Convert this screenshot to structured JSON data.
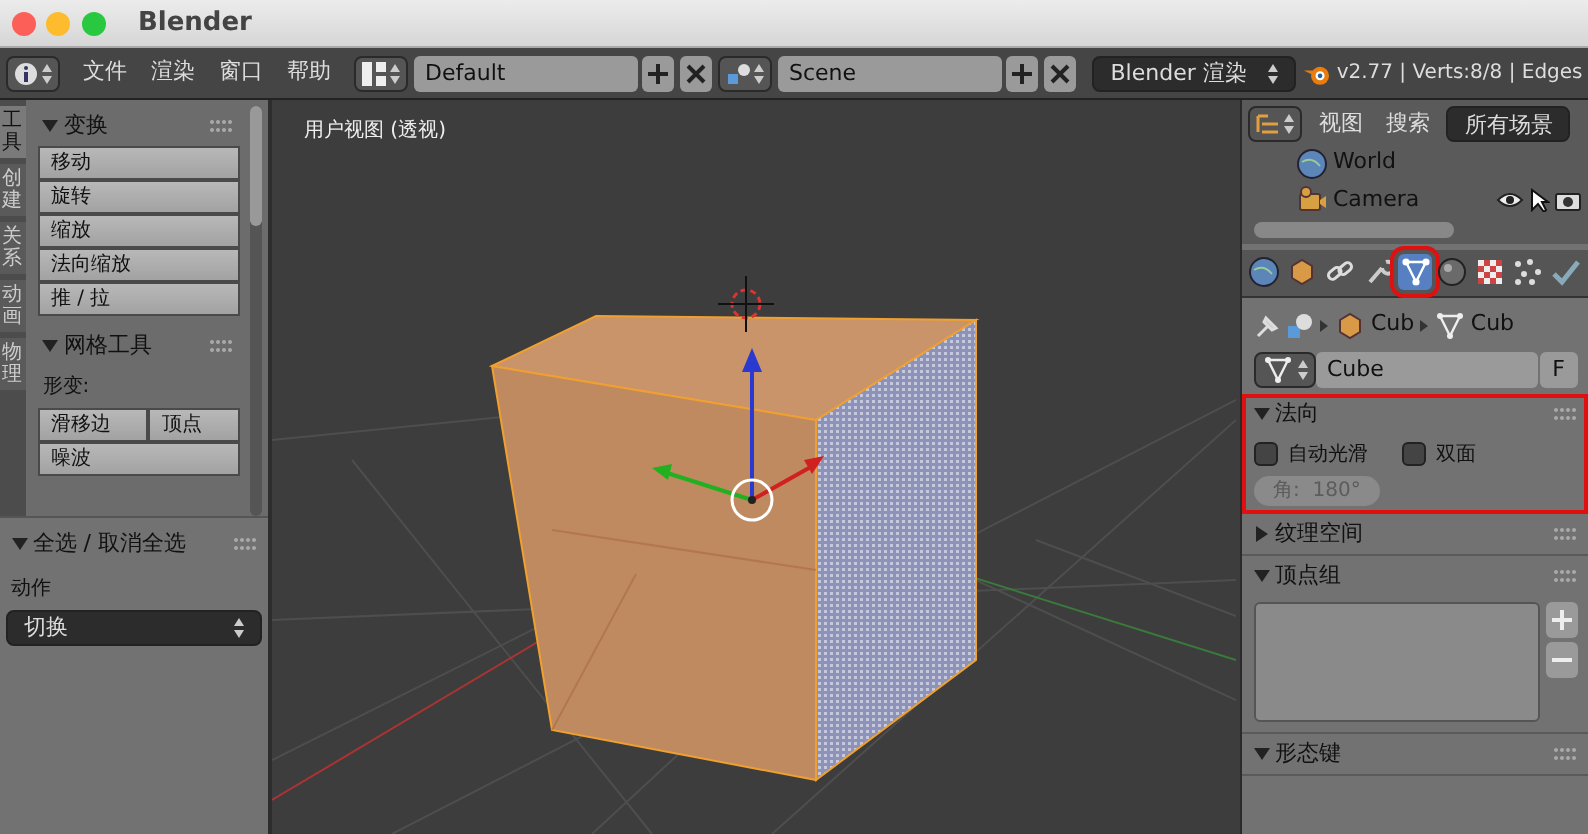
{
  "window": {
    "title": "Blender"
  },
  "header": {
    "menus": [
      "文件",
      "渲染",
      "窗口",
      "帮助"
    ],
    "screen_layout": "Default",
    "scene": "Scene",
    "render_engine": "Blender 渲染",
    "stats": "v2.77 | Verts:8/8 | Edges"
  },
  "tool_shelf": {
    "tabs": [
      {
        "label": "工具",
        "selected": true
      },
      {
        "label": "创建",
        "selected": false
      },
      {
        "label": "关系",
        "selected": false
      },
      {
        "label": "动画",
        "selected": false
      },
      {
        "label": "物理",
        "selected": false
      }
    ],
    "panels": [
      {
        "title": "变换",
        "expanded": true,
        "buttons": [
          "移动",
          "旋转",
          "缩放",
          "法向缩放",
          "推 / 拉"
        ]
      },
      {
        "title": "网格工具",
        "expanded": true,
        "label": "形变:",
        "button_rows": [
          [
            "滑移边",
            "顶点"
          ],
          [
            "噪波"
          ]
        ]
      }
    ]
  },
  "operator_panel": {
    "title": "全选 / 取消全选",
    "expanded": true,
    "label": "动作",
    "value": "切换"
  },
  "viewport": {
    "label": "用户视图 (透视)"
  },
  "outliner": {
    "buttons": [
      "视图",
      "搜索"
    ],
    "filter": "所有场景",
    "items": [
      {
        "label": "World",
        "kind": "world"
      },
      {
        "label": "Camera",
        "kind": "camera"
      }
    ]
  },
  "properties": {
    "tabs": [
      {
        "kind": "world",
        "selected": false,
        "highlight": false
      },
      {
        "kind": "object",
        "selected": false,
        "highlight": false
      },
      {
        "kind": "constraints",
        "selected": false,
        "highlight": false
      },
      {
        "kind": "modifiers",
        "selected": false,
        "highlight": false
      },
      {
        "kind": "data",
        "selected": true,
        "highlight": true
      },
      {
        "kind": "material",
        "selected": false,
        "highlight": false
      },
      {
        "kind": "texture",
        "selected": false,
        "highlight": false
      },
      {
        "kind": "particles",
        "selected": false,
        "highlight": false
      },
      {
        "kind": "physics",
        "selected": false,
        "highlight": false
      }
    ],
    "breadcrumb": [
      {
        "label": "Cub",
        "kind": "object"
      },
      {
        "label": "Cub",
        "kind": "mesh"
      }
    ],
    "datablock": {
      "name": "Cube",
      "fake_user": "F"
    },
    "panels": [
      {
        "title": "法向",
        "kind": "options",
        "expanded": true,
        "highlight": true,
        "checkboxes": [
          {
            "label": "自动光滑",
            "checked": false
          },
          {
            "label": "双面",
            "checked": false
          }
        ],
        "angle": {
          "value": "角:  180°",
          "disabled": true
        }
      },
      {
        "title": "纹理空间",
        "kind": "plain",
        "expanded": false,
        "highlight": false
      },
      {
        "title": "顶点组",
        "kind": "list",
        "expanded": true,
        "highlight": false
      },
      {
        "title": "形态键",
        "kind": "plain",
        "expanded": true,
        "highlight": false
      }
    ]
  }
}
